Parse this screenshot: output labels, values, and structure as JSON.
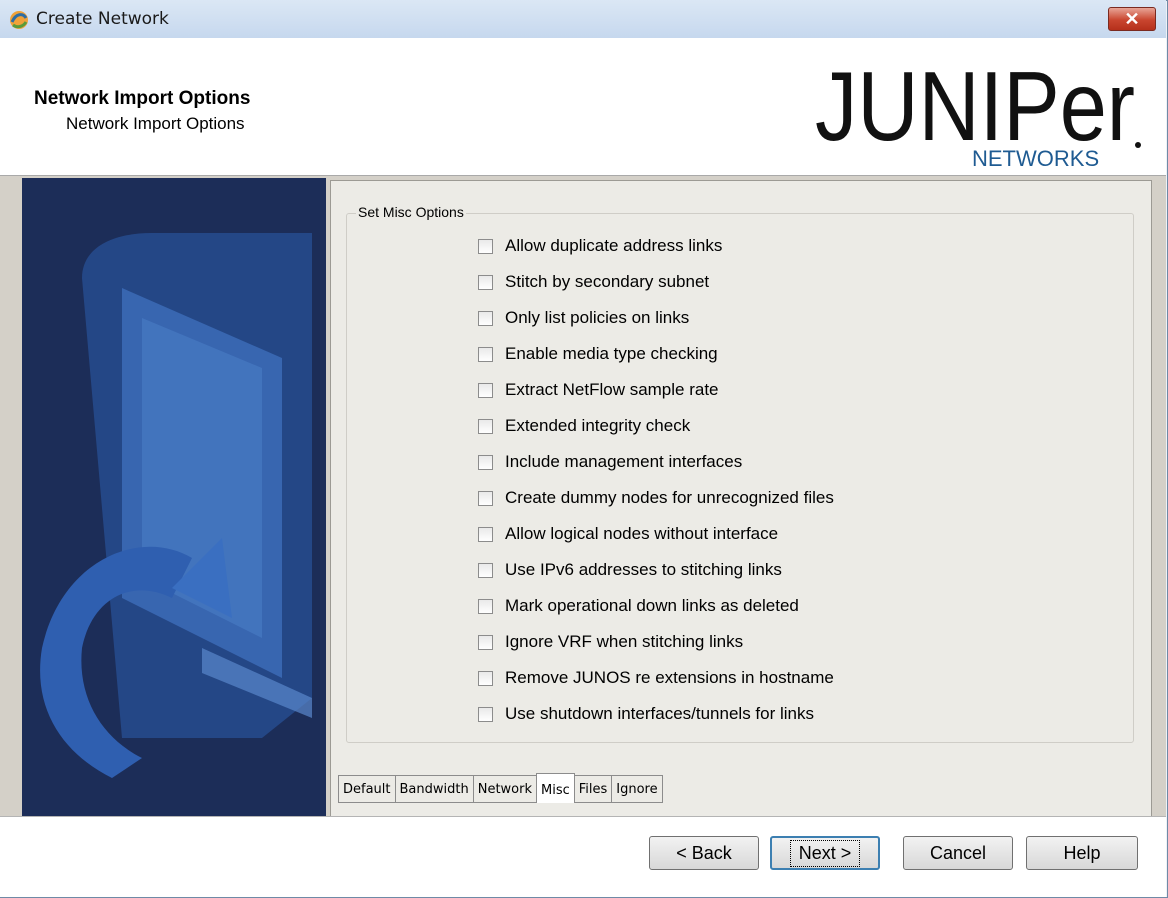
{
  "window": {
    "title": "Create Network",
    "close_icon": "close-icon"
  },
  "header": {
    "title": "Network Import Options",
    "subtitle": "Network Import Options",
    "logo_text": "JUNIPer",
    "logo_subtext": "NETWORKS"
  },
  "options_group": {
    "label": "Set Misc Options",
    "options": [
      {
        "label": "Allow duplicate address links",
        "checked": false
      },
      {
        "label": "Stitch by secondary subnet",
        "checked": false
      },
      {
        "label": "Only list policies on links",
        "checked": false
      },
      {
        "label": "Enable media type checking",
        "checked": false
      },
      {
        "label": "Extract NetFlow sample rate",
        "checked": false
      },
      {
        "label": "Extended integrity check",
        "checked": false
      },
      {
        "label": "Include management interfaces",
        "checked": false
      },
      {
        "label": "Create dummy nodes for unrecognized files",
        "checked": false
      },
      {
        "label": "Allow logical nodes without interface",
        "checked": false
      },
      {
        "label": "Use IPv6 addresses to stitching links",
        "checked": false
      },
      {
        "label": "Mark operational down links as deleted",
        "checked": false
      },
      {
        "label": "Ignore VRF when stitching links",
        "checked": false
      },
      {
        "label": "Remove JUNOS re extensions in hostname",
        "checked": false
      },
      {
        "label": "Use shutdown interfaces/tunnels for links",
        "checked": false
      }
    ]
  },
  "tabs": [
    {
      "label": "Default"
    },
    {
      "label": "Bandwidth"
    },
    {
      "label": "Network"
    },
    {
      "label": "Misc",
      "active": true
    },
    {
      "label": "Files"
    },
    {
      "label": "Ignore"
    }
  ],
  "buttons": {
    "back": "< Back",
    "next": "Next >",
    "cancel": "Cancel",
    "help": "Help"
  },
  "colors": {
    "side_panel": "#1c2d58",
    "logo_accent": "#1f5b92",
    "close": "#c9452f"
  }
}
